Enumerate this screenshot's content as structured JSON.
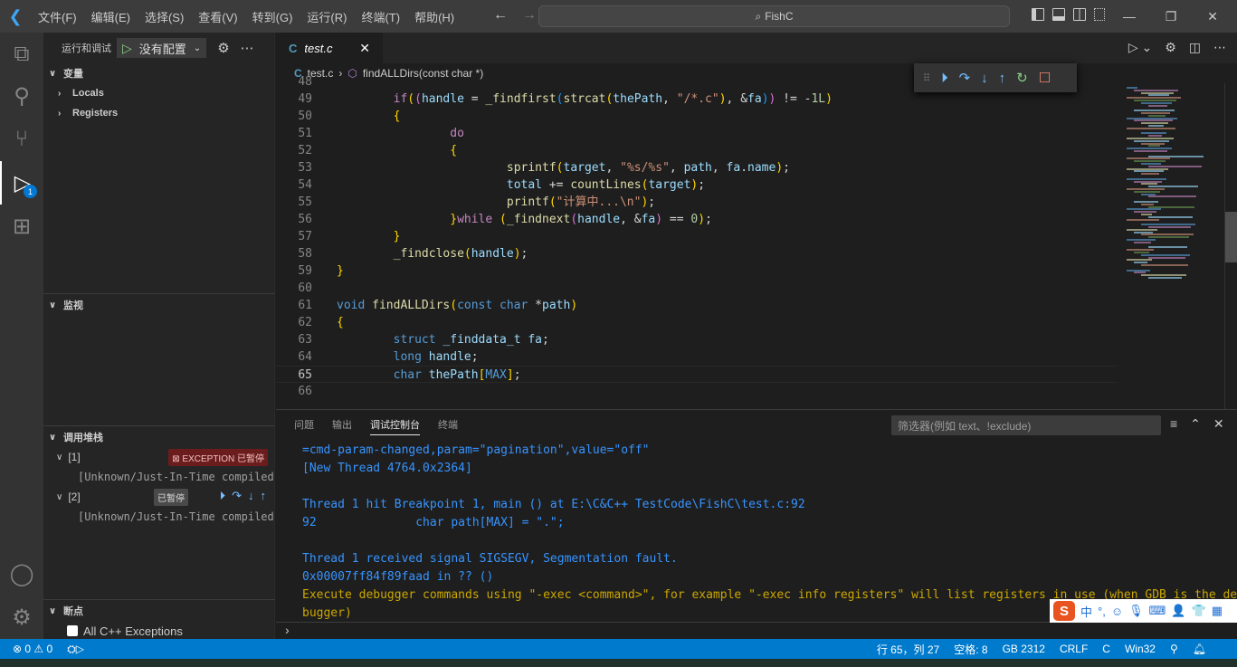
{
  "titlebar": {
    "menus": [
      "文件(F)",
      "编辑(E)",
      "选择(S)",
      "查看(V)",
      "转到(G)",
      "运行(R)",
      "终端(T)",
      "帮助(H)"
    ],
    "search": "FishC",
    "nav_back": "←",
    "nav_forward": "→",
    "window_controls": {
      "minimize": "—",
      "restore": "❐",
      "close": "✕"
    }
  },
  "activity_bar": {
    "items": [
      {
        "name": "explorer",
        "icon": "files-icon"
      },
      {
        "name": "search",
        "icon": "search-icon"
      },
      {
        "name": "source-control",
        "icon": "source-control-icon"
      },
      {
        "name": "run-debug",
        "icon": "run-debug-icon",
        "active": true,
        "badge": "1"
      },
      {
        "name": "extensions",
        "icon": "extensions-icon"
      }
    ],
    "bottom": [
      "account-icon",
      "manage-gear-icon"
    ]
  },
  "sidebar": {
    "title": "运行和调试",
    "config": "没有配置",
    "variables": {
      "title": "变量",
      "items": [
        "Locals",
        "Registers"
      ]
    },
    "watch": {
      "title": "监视"
    },
    "callstack": {
      "title": "调用堆栈",
      "threads": [
        {
          "label": "[1]",
          "badge": "EXCEPTION 已暂停",
          "frame": "[Unknown/Just-In-Time compiled"
        },
        {
          "label": "[2]",
          "badge": "已暂停",
          "frame": "[Unknown/Just-In-Time compiled"
        }
      ]
    },
    "breakpoints": {
      "title": "断点",
      "items": [
        {
          "label": "All C++ Exceptions",
          "checked": false
        }
      ]
    }
  },
  "editor": {
    "tab": {
      "name": "test.c",
      "icon": "C"
    },
    "breadcrumb": {
      "file": "test.c",
      "symbol": "findALLDirs(const char *)"
    },
    "current_line": 65,
    "lines": [
      {
        "n": "48",
        "html": ""
      },
      {
        "n": "49",
        "code": "        if((handle = _findfirst(strcat(thePath, \"/*.c\"), &fa)) != -1L)"
      },
      {
        "n": "50",
        "code": "        {"
      },
      {
        "n": "51",
        "code": "                do"
      },
      {
        "n": "52",
        "code": "                {"
      },
      {
        "n": "53",
        "code": "                        sprintf(target, \"%s/%s\", path, fa.name);"
      },
      {
        "n": "54",
        "code": "                        total += countLines(target);"
      },
      {
        "n": "55",
        "code": "                        printf(\"计算中...\\n\");"
      },
      {
        "n": "56",
        "code": "                }while (_findnext(handle, &fa) == 0);"
      },
      {
        "n": "57",
        "code": "        }"
      },
      {
        "n": "58",
        "code": "        _findclose(handle);"
      },
      {
        "n": "59",
        "code": "}"
      },
      {
        "n": "60",
        "code": ""
      },
      {
        "n": "61",
        "code": "void findALLDirs(const char *path)"
      },
      {
        "n": "62",
        "code": "{"
      },
      {
        "n": "63",
        "code": "        struct _finddata_t fa;"
      },
      {
        "n": "64",
        "code": "        long handle;"
      },
      {
        "n": "65",
        "code": "        char thePath[MAX];"
      },
      {
        "n": "66",
        "code": ""
      }
    ]
  },
  "panel": {
    "tabs": [
      "问题",
      "输出",
      "调试控制台",
      "终端"
    ],
    "active_tab": "调试控制台",
    "filter_placeholder": "筛选器(例如 text、!exclude)",
    "console": [
      {
        "text": "=cmd-param-changed,param=\"pagination\",value=\"off\"",
        "color": "blue"
      },
      {
        "text": "[New Thread 4764.0x2364]",
        "color": "blue"
      },
      {
        "text": "",
        "color": "blue"
      },
      {
        "text": "Thread 1 hit Breakpoint 1, main () at E:\\C&C++ TestCode\\FishC\\test.c:92",
        "color": "blue"
      },
      {
        "text": "92              char path[MAX] = \".\";",
        "color": "blue"
      },
      {
        "text": "",
        "color": "blue"
      },
      {
        "text": "Thread 1 received signal SIGSEGV, Segmentation fault.",
        "color": "blue"
      },
      {
        "text": "0x00007ff84f89faad in ?? ()",
        "color": "blue"
      },
      {
        "text": "Execute debugger commands using \"-exec <command>\", for example \"-exec info registers\" will list registers in use (when GDB is the de",
        "color": "orange"
      },
      {
        "text": "bugger)",
        "color": "orange"
      }
    ],
    "prompt": "›"
  },
  "ime": {
    "logo": "S",
    "mode": "中",
    "punct": "°,"
  },
  "statusbar": {
    "errors": "0",
    "warnings": "0",
    "position": "行 65，列 27",
    "indent": "空格: 8",
    "encoding": "GB 2312",
    "eol": "CRLF",
    "language": "C",
    "platform": "Win32"
  }
}
